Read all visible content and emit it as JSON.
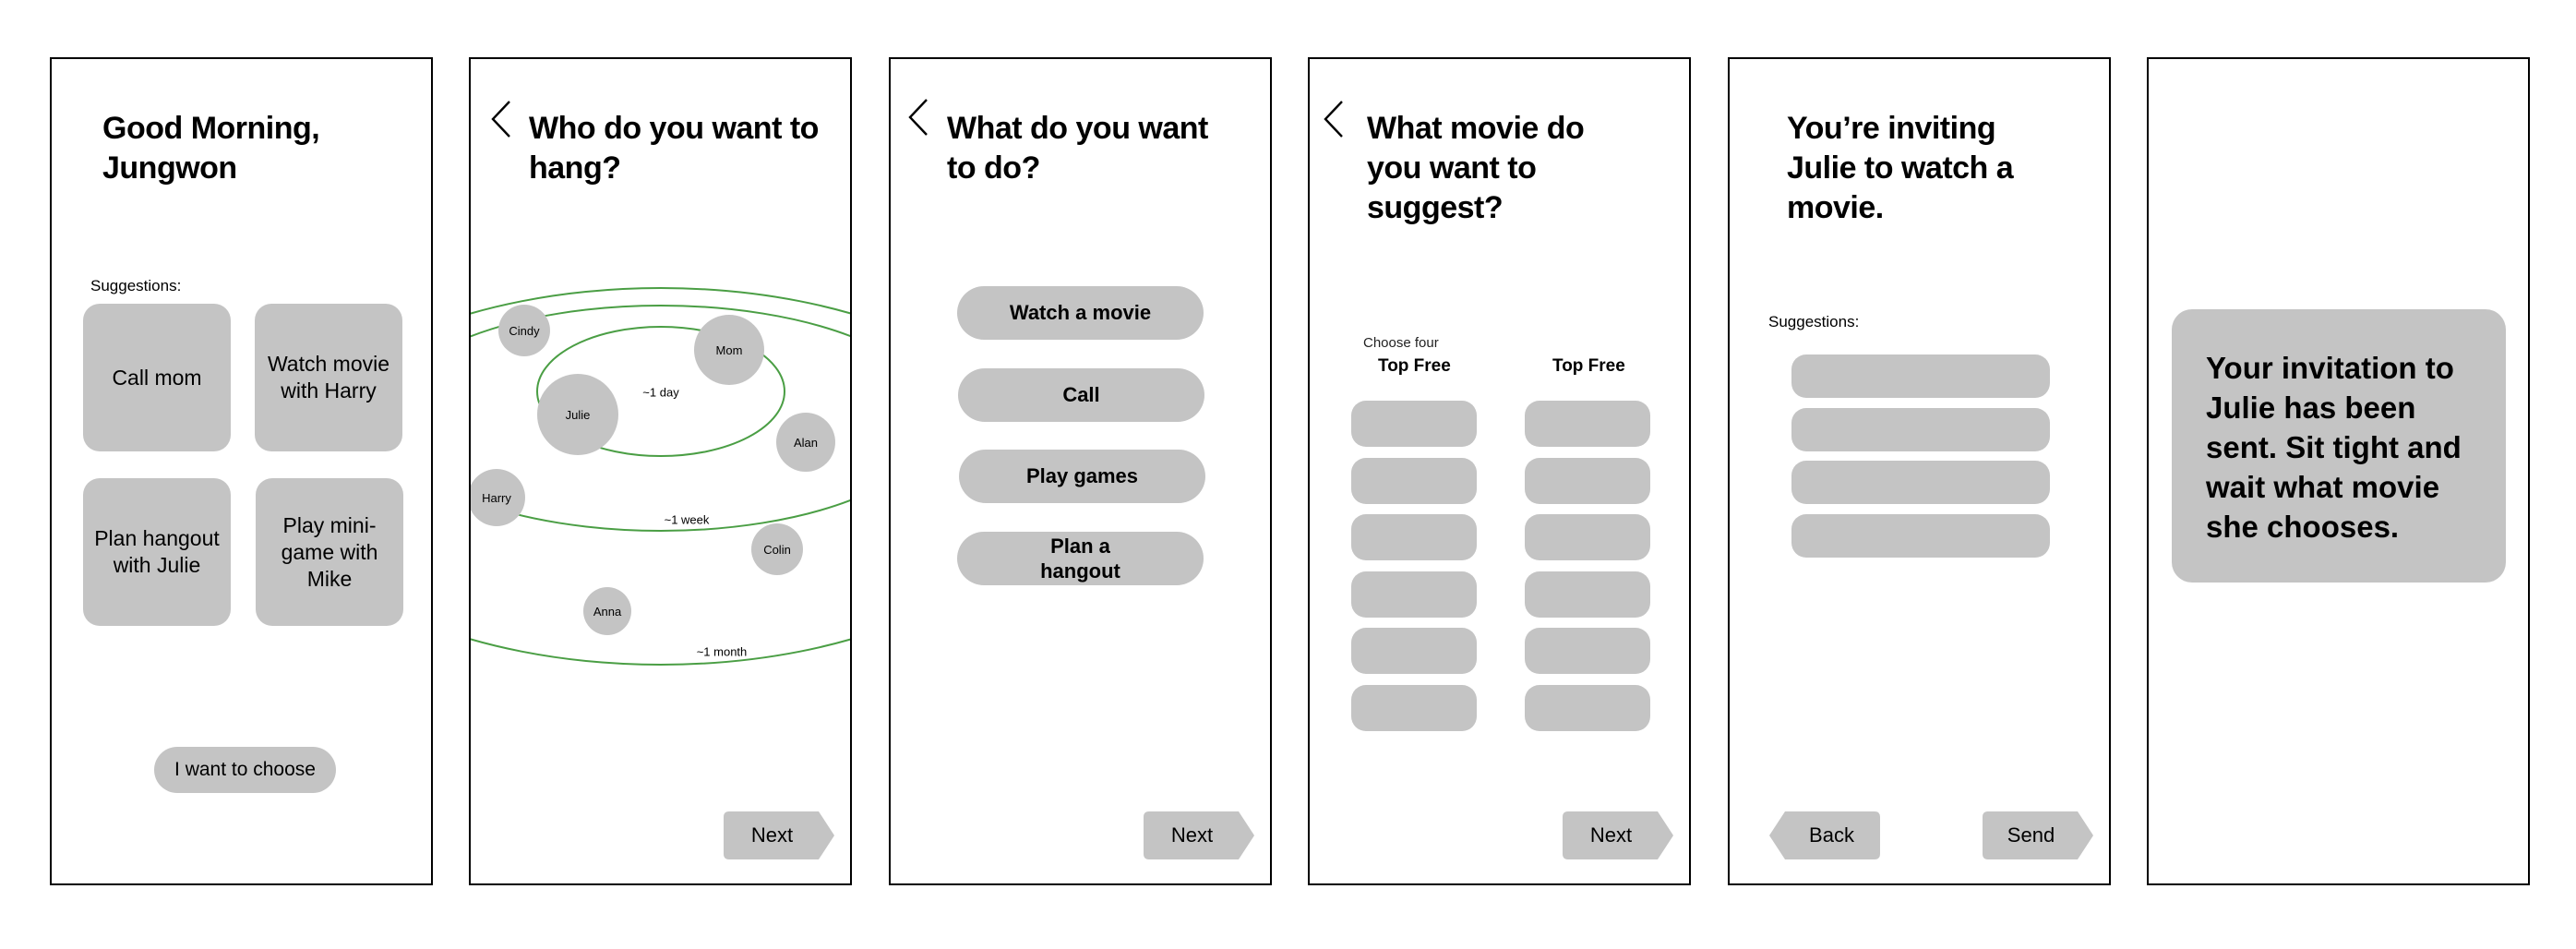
{
  "screens": {
    "home": {
      "greeting": "Good Morning, Jungwon",
      "suggestions_label": "Suggestions:",
      "suggestions": [
        {
          "label": "Call mom"
        },
        {
          "label": "Watch movie with Harry"
        },
        {
          "label": "Plan hangout with Julie"
        },
        {
          "label": "Play mini-game with Mike"
        }
      ],
      "choose_button": "I want to choose"
    },
    "who": {
      "back_icon": "chevron-left-icon",
      "title": "Who do you want to hang?",
      "orbit_labels": [
        "~1 day",
        "~1 week",
        "~1 month"
      ],
      "orbit_color": "#4a9e44",
      "people": [
        {
          "name": "Cindy",
          "ring": "~1 week"
        },
        {
          "name": "Mom",
          "ring": "~1 day"
        },
        {
          "name": "Julie",
          "ring": "~1 day"
        },
        {
          "name": "Alan",
          "ring": "~1 week"
        },
        {
          "name": "Harry",
          "ring": "~1 week"
        },
        {
          "name": "Colin",
          "ring": "~1 month"
        },
        {
          "name": "Anna",
          "ring": "~1 month"
        }
      ],
      "next_button": "Next"
    },
    "what": {
      "back_icon": "chevron-left-icon",
      "title": "What do you want to do?",
      "options": [
        {
          "label": "Watch a movie"
        },
        {
          "label": "Call"
        },
        {
          "label": "Play games"
        },
        {
          "label": "Plan a hangout"
        }
      ],
      "next_button": "Next"
    },
    "movie": {
      "back_icon": "chevron-left-icon",
      "title": "What movie do you want to suggest?",
      "hint": "Choose four",
      "columns": [
        {
          "heading": "Top Free",
          "slots": 6
        },
        {
          "heading": "Top Free",
          "slots": 6
        }
      ],
      "next_button": "Next"
    },
    "invite": {
      "title": "You’re inviting Julie to watch a movie.",
      "suggestions_label": "Suggestions:",
      "suggestion_slots": 4,
      "back_button": "Back",
      "send_button": "Send"
    },
    "sent": {
      "message": "Your invitation to Julie has been sent. Sit tight and wait what movie she chooses."
    }
  },
  "colors": {
    "placeholder_gray": "#c4c4c4",
    "frame_border": "#000000",
    "orbit_green": "#4a9e44"
  }
}
